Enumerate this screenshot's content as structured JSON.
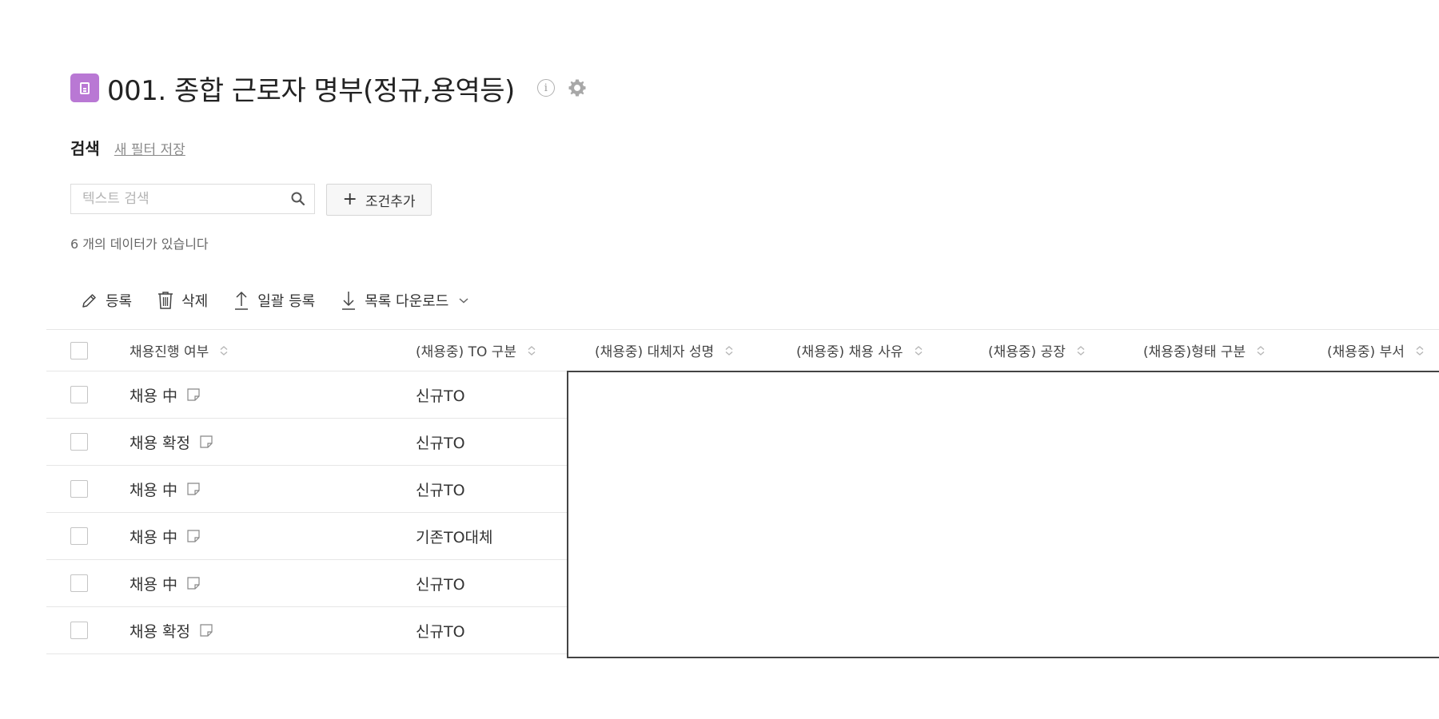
{
  "header": {
    "title": "001. 종합 근로자 명부(정규,용역등)",
    "info_glyph": "i"
  },
  "search": {
    "label": "검색",
    "save_filter": "새 필터 저장",
    "placeholder": "텍스트 검색",
    "add_condition": "조건추가",
    "add_condition_prefix": "+",
    "record_count": "6 개의 데이터가 있습니다"
  },
  "toolbar": {
    "register": "등록",
    "delete": "삭제",
    "bulk_register": "일괄 등록",
    "download": "목록 다운로드"
  },
  "table": {
    "columns": [
      "채용진행 여부",
      "(채용중) TO 구분",
      "(채용중) 대체자 성명",
      "(채용중) 채용 사유",
      "(채용중) 공장",
      "(채용중)형태 구분",
      "(채용중) 부서"
    ],
    "rows": [
      {
        "status": "채용 中",
        "to_type": "신규TO"
      },
      {
        "status": "채용 확정",
        "to_type": "신규TO"
      },
      {
        "status": "채용 中",
        "to_type": "신규TO"
      },
      {
        "status": "채용 中",
        "to_type": "기존TO대체"
      },
      {
        "status": "채용 中",
        "to_type": "신규TO"
      },
      {
        "status": "채용 확정",
        "to_type": "신규TO"
      }
    ]
  },
  "colors": {
    "app_icon": "#b978d4",
    "border": "#e6e6e6"
  }
}
